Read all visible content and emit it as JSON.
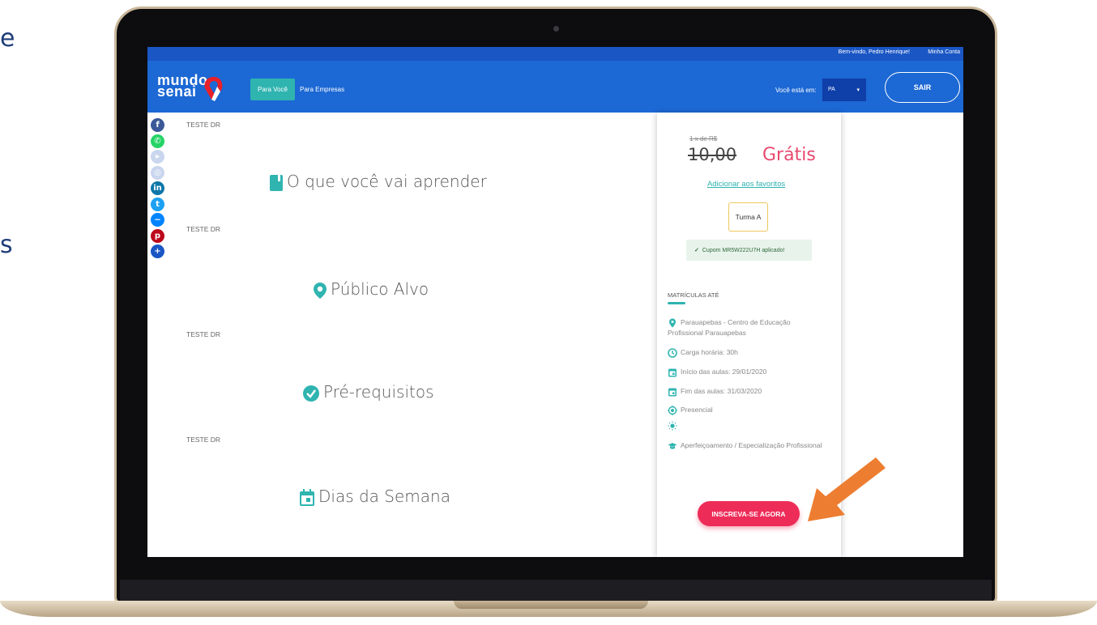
{
  "slide_fragments": [
    "e",
    "s"
  ],
  "topbar": {
    "welcome": "Bem-vindo, Pedro Henrique!",
    "account": "Minha Conta"
  },
  "logo": {
    "line1": "mundo",
    "line2": "senai"
  },
  "nav": {
    "para_voce": "Para Você",
    "para_empresas": "Para Empresas",
    "location_label": "Você está em:",
    "state": "PA",
    "logout": "SAIR"
  },
  "social_icons": [
    "facebook-icon",
    "whatsapp-icon",
    "youtube-icon",
    "instagram-icon",
    "linkedin-icon",
    "twitter-icon",
    "messenger-icon",
    "pinterest-icon",
    "share-plus-icon"
  ],
  "sections": [
    {
      "note": "TESTE DR",
      "title": "O que você vai aprender",
      "icon": "book-icon"
    },
    {
      "note": "TESTE DR",
      "title": "Público Alvo",
      "icon": "location-pin-icon"
    },
    {
      "note": "TESTE DR",
      "title": "Pré-requisitos",
      "icon": "check-circle-icon"
    },
    {
      "note": "TESTE DR",
      "title": "Dias da Semana",
      "icon": "calendar-icon"
    }
  ],
  "sidebar": {
    "price_small": "1 x de R$",
    "price_old": "10,00",
    "price_free": "Grátis",
    "favorites": "Adicionar aos favoritos",
    "class": "Turma A",
    "coupon": "Cupom MR5W222U7H aplicado!",
    "enroll_until": "MATRÍCULAS ATÉ",
    "location": "Parauapebas - Centro de Educação Profissional Parauapebas",
    "workload": "Carga horária: 30h",
    "start": "Início das aulas: 29/01/2020",
    "end": "Fim das aulas: 31/03/2020",
    "mode": "Presencial",
    "category": "Aperfeiçoamento / Especialização Profissional",
    "enroll_button": "INSCREVA-SE AGORA"
  },
  "colors": {
    "brand_blue": "#1c68d4",
    "teal": "#2fb4b0",
    "pink": "#ee2c58",
    "arrow": "#ed7d31"
  }
}
